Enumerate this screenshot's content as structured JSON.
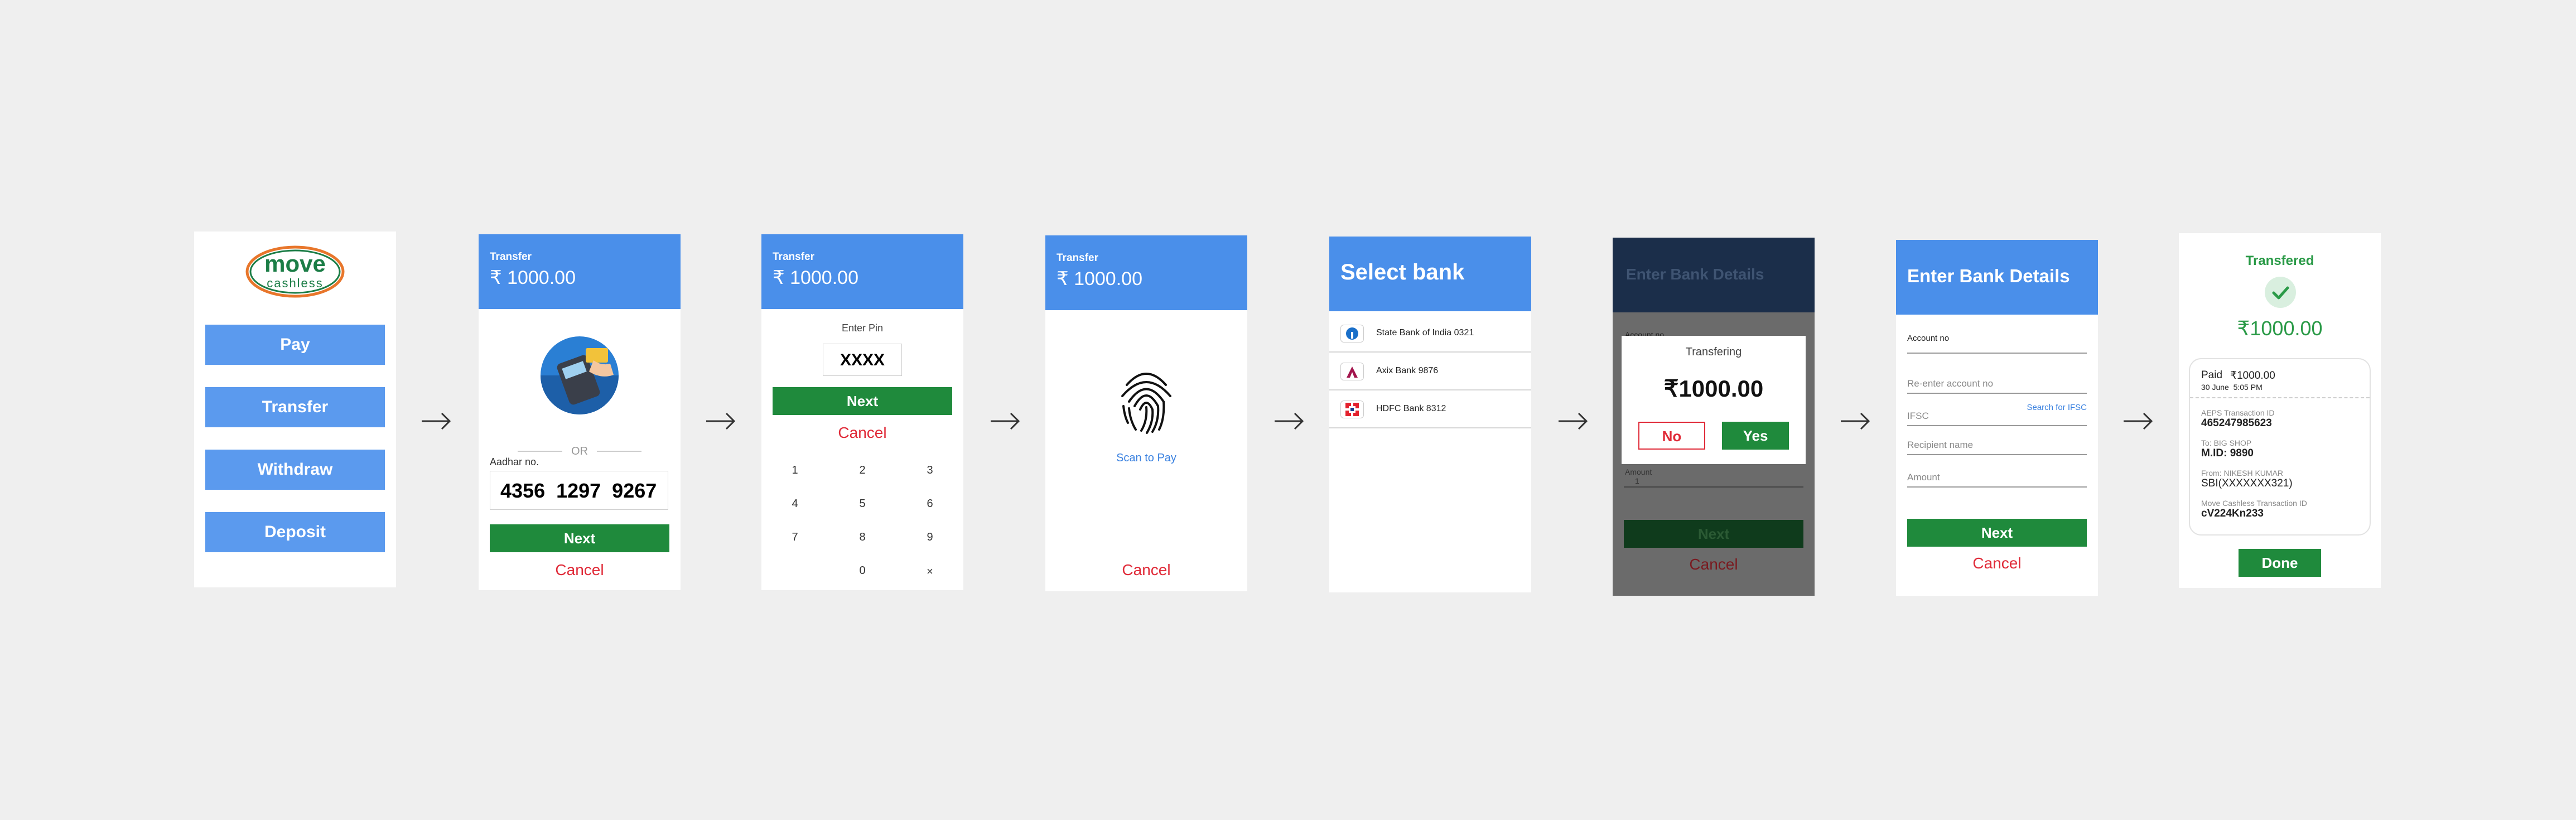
{
  "colors": {
    "primary_blue": "#4a8fea",
    "green": "#1f8a3c",
    "red": "#e02a38",
    "background": "#efefef"
  },
  "icons": {
    "arrow": "arrow-right-icon",
    "fingerprint": "fingerprint-icon",
    "check": "check-icon",
    "card_terminal": "card-terminal-icon"
  },
  "home": {
    "logo_top": "move",
    "logo_bottom": "cashless",
    "buttons": [
      "Pay",
      "Transfer",
      "Withdraw",
      "Deposit"
    ]
  },
  "aadhar_screen": {
    "header_label": "Transfer",
    "amount": "₹ 1000.00",
    "or_text": "OR",
    "aadhar_label": "Aadhar no.",
    "aadhar_value": "4356  1297  9267",
    "next": "Next",
    "cancel": "Cancel"
  },
  "pin_screen": {
    "header_label": "Transfer",
    "amount": "₹ 1000.00",
    "enter_pin_label": "Enter Pin",
    "pin_value": "XXXX",
    "next": "Next",
    "cancel": "Cancel",
    "keypad": [
      "1",
      "2",
      "3",
      "4",
      "5",
      "6",
      "7",
      "8",
      "9",
      "",
      "0",
      "×"
    ]
  },
  "scan_screen": {
    "header_label": "Transfer",
    "amount": "₹ 1000.00",
    "scan_label": "Scan to Pay",
    "cancel": "Cancel"
  },
  "select_bank_screen": {
    "title": "Select bank",
    "banks": [
      "State Bank of India 0321",
      "Axix Bank 9876",
      "HDFC Bank 8312"
    ]
  },
  "confirm_screen": {
    "title": "Enter Bank Details",
    "bg_label": "Account no",
    "bg_amount_label": "Amount",
    "bg_amount_value": "1",
    "bg_next": "Next",
    "bg_cancel": "Cancel",
    "dialog_title": "Transfering",
    "dialog_amount": "₹1000.00",
    "no": "No",
    "yes": "Yes"
  },
  "bank_details_screen": {
    "title": "Enter Bank Details",
    "account_label": "Account no",
    "reenter_placeholder": "Re-enter account no",
    "ifsc_placeholder": "IFSC",
    "search_ifsc": "Search for IFSC",
    "recipient_placeholder": "Recipient name",
    "amount_placeholder": "Amount",
    "next": "Next",
    "cancel": "Cancel"
  },
  "success_screen": {
    "title": "Transfered",
    "amount": "₹1000.00",
    "paid_label": "Paid",
    "paid_amount": "₹1000.00",
    "date": "30 June  5:05 PM",
    "aeps_label": "AEPS Transaction ID",
    "aeps_value": "465247985623",
    "to_label": "To: BIG SHOP",
    "mid_value": "M.ID: 9890",
    "from_label": "From: NIKESH KUMAR",
    "from_value": "SBI(XXXXXXX321)",
    "mc_label": "Move Cashless Transaction ID",
    "mc_value": "cV224Kn233",
    "done": "Done"
  }
}
